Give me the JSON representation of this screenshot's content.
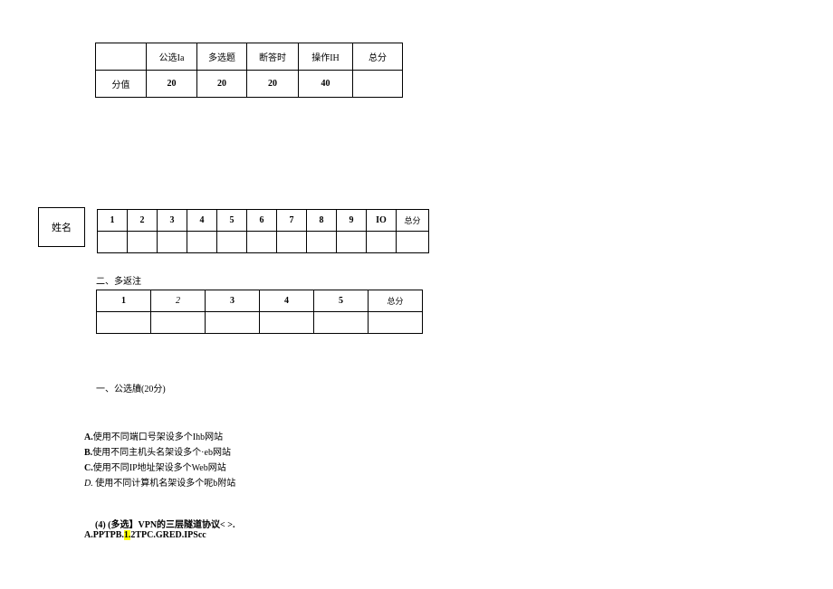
{
  "scoreTable": {
    "headers": [
      "",
      "公选Ia",
      "多选题",
      "断答时",
      "操作IH",
      "总分"
    ],
    "row2": [
      "分值",
      "20",
      "20",
      "20",
      "40",
      ""
    ]
  },
  "nameBox": "姓名",
  "q1": {
    "headers": [
      "1",
      "2",
      "3",
      "4",
      "5",
      "6",
      "7",
      "8",
      "9",
      "IO",
      "总分"
    ]
  },
  "section2Label": "二、多返注",
  "q2": {
    "headers": [
      "1",
      "2",
      "3",
      "4",
      "5",
      "总分"
    ]
  },
  "section1Heading": "一、公选牘(20分)",
  "answers": {
    "a_prefix": "A.",
    "a": "使用不同端口号架设多个Ihb网站",
    "b_prefix": "B.",
    "b": "使用不同主机头名架设多个·eb网站",
    "c_prefix": "C.",
    "c": "使用不同IP地址架设多个Web网站",
    "d_prefix": "D.",
    "d": " 使用不同计算机名架设多个呢b附站"
  },
  "q4": {
    "line": "(4)   (多选】VPN的三层隧道协议<        >.",
    "ans_before": "A.PPTPB.",
    "ans_hl": "1.",
    "ans_after": "2TPC.GRED.IPScc"
  }
}
